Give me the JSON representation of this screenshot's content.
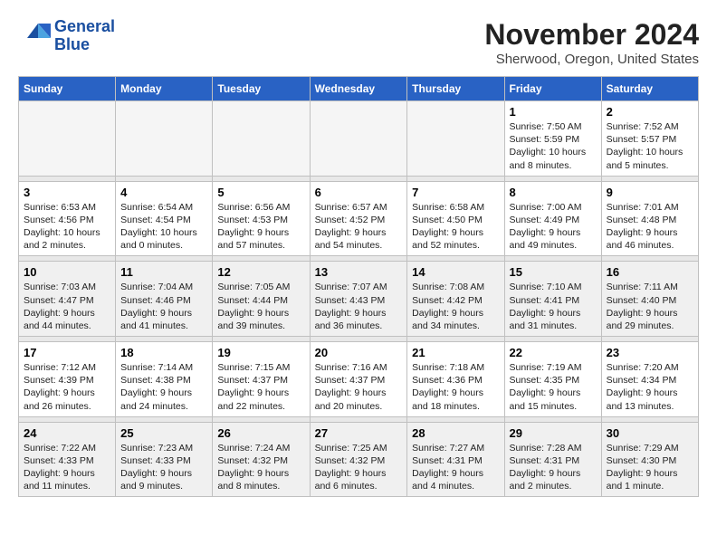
{
  "logo": {
    "name": "General Blue",
    "line1": "General",
    "line2": "Blue"
  },
  "header": {
    "month": "November 2024",
    "location": "Sherwood, Oregon, United States"
  },
  "weekdays": [
    "Sunday",
    "Monday",
    "Tuesday",
    "Wednesday",
    "Thursday",
    "Friday",
    "Saturday"
  ],
  "weeks": [
    {
      "days": [
        {
          "num": "",
          "info": "",
          "empty": true
        },
        {
          "num": "",
          "info": "",
          "empty": true
        },
        {
          "num": "",
          "info": "",
          "empty": true
        },
        {
          "num": "",
          "info": "",
          "empty": true
        },
        {
          "num": "",
          "info": "",
          "empty": true
        },
        {
          "num": "1",
          "info": "Sunrise: 7:50 AM\nSunset: 5:59 PM\nDaylight: 10 hours\nand 8 minutes."
        },
        {
          "num": "2",
          "info": "Sunrise: 7:52 AM\nSunset: 5:57 PM\nDaylight: 10 hours\nand 5 minutes."
        }
      ]
    },
    {
      "days": [
        {
          "num": "3",
          "info": "Sunrise: 6:53 AM\nSunset: 4:56 PM\nDaylight: 10 hours\nand 2 minutes."
        },
        {
          "num": "4",
          "info": "Sunrise: 6:54 AM\nSunset: 4:54 PM\nDaylight: 10 hours\nand 0 minutes."
        },
        {
          "num": "5",
          "info": "Sunrise: 6:56 AM\nSunset: 4:53 PM\nDaylight: 9 hours\nand 57 minutes."
        },
        {
          "num": "6",
          "info": "Sunrise: 6:57 AM\nSunset: 4:52 PM\nDaylight: 9 hours\nand 54 minutes."
        },
        {
          "num": "7",
          "info": "Sunrise: 6:58 AM\nSunset: 4:50 PM\nDaylight: 9 hours\nand 52 minutes."
        },
        {
          "num": "8",
          "info": "Sunrise: 7:00 AM\nSunset: 4:49 PM\nDaylight: 9 hours\nand 49 minutes."
        },
        {
          "num": "9",
          "info": "Sunrise: 7:01 AM\nSunset: 4:48 PM\nDaylight: 9 hours\nand 46 minutes."
        }
      ]
    },
    {
      "days": [
        {
          "num": "10",
          "info": "Sunrise: 7:03 AM\nSunset: 4:47 PM\nDaylight: 9 hours\nand 44 minutes."
        },
        {
          "num": "11",
          "info": "Sunrise: 7:04 AM\nSunset: 4:46 PM\nDaylight: 9 hours\nand 41 minutes."
        },
        {
          "num": "12",
          "info": "Sunrise: 7:05 AM\nSunset: 4:44 PM\nDaylight: 9 hours\nand 39 minutes."
        },
        {
          "num": "13",
          "info": "Sunrise: 7:07 AM\nSunset: 4:43 PM\nDaylight: 9 hours\nand 36 minutes."
        },
        {
          "num": "14",
          "info": "Sunrise: 7:08 AM\nSunset: 4:42 PM\nDaylight: 9 hours\nand 34 minutes."
        },
        {
          "num": "15",
          "info": "Sunrise: 7:10 AM\nSunset: 4:41 PM\nDaylight: 9 hours\nand 31 minutes."
        },
        {
          "num": "16",
          "info": "Sunrise: 7:11 AM\nSunset: 4:40 PM\nDaylight: 9 hours\nand 29 minutes."
        }
      ]
    },
    {
      "days": [
        {
          "num": "17",
          "info": "Sunrise: 7:12 AM\nSunset: 4:39 PM\nDaylight: 9 hours\nand 26 minutes."
        },
        {
          "num": "18",
          "info": "Sunrise: 7:14 AM\nSunset: 4:38 PM\nDaylight: 9 hours\nand 24 minutes."
        },
        {
          "num": "19",
          "info": "Sunrise: 7:15 AM\nSunset: 4:37 PM\nDaylight: 9 hours\nand 22 minutes."
        },
        {
          "num": "20",
          "info": "Sunrise: 7:16 AM\nSunset: 4:37 PM\nDaylight: 9 hours\nand 20 minutes."
        },
        {
          "num": "21",
          "info": "Sunrise: 7:18 AM\nSunset: 4:36 PM\nDaylight: 9 hours\nand 18 minutes."
        },
        {
          "num": "22",
          "info": "Sunrise: 7:19 AM\nSunset: 4:35 PM\nDaylight: 9 hours\nand 15 minutes."
        },
        {
          "num": "23",
          "info": "Sunrise: 7:20 AM\nSunset: 4:34 PM\nDaylight: 9 hours\nand 13 minutes."
        }
      ]
    },
    {
      "days": [
        {
          "num": "24",
          "info": "Sunrise: 7:22 AM\nSunset: 4:33 PM\nDaylight: 9 hours\nand 11 minutes."
        },
        {
          "num": "25",
          "info": "Sunrise: 7:23 AM\nSunset: 4:33 PM\nDaylight: 9 hours\nand 9 minutes."
        },
        {
          "num": "26",
          "info": "Sunrise: 7:24 AM\nSunset: 4:32 PM\nDaylight: 9 hours\nand 8 minutes."
        },
        {
          "num": "27",
          "info": "Sunrise: 7:25 AM\nSunset: 4:32 PM\nDaylight: 9 hours\nand 6 minutes."
        },
        {
          "num": "28",
          "info": "Sunrise: 7:27 AM\nSunset: 4:31 PM\nDaylight: 9 hours\nand 4 minutes."
        },
        {
          "num": "29",
          "info": "Sunrise: 7:28 AM\nSunset: 4:31 PM\nDaylight: 9 hours\nand 2 minutes."
        },
        {
          "num": "30",
          "info": "Sunrise: 7:29 AM\nSunset: 4:30 PM\nDaylight: 9 hours\nand 1 minute."
        }
      ]
    }
  ]
}
